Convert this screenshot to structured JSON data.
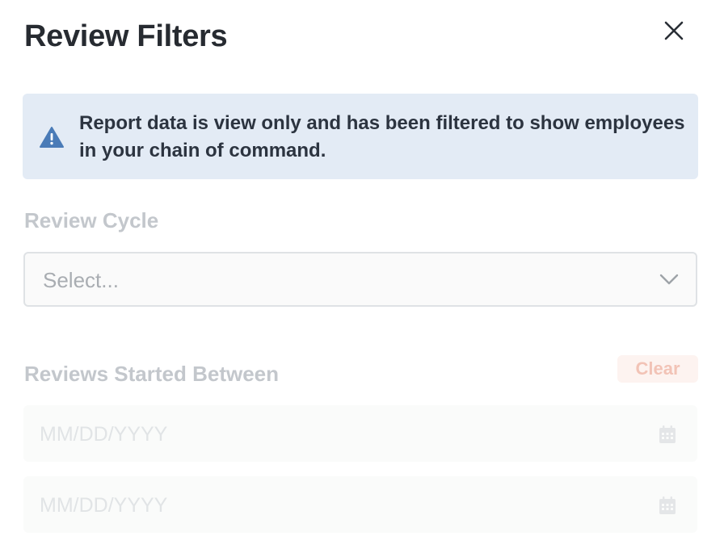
{
  "dialog": {
    "title": "Review Filters",
    "close_icon": "close-icon"
  },
  "alert": {
    "icon": "warning-triangle-icon",
    "message": "Report data is view only and has been filtered to show employees in your chain of command."
  },
  "review_cycle": {
    "label": "Review Cycle",
    "placeholder": "Select...",
    "icon": "chevron-down-icon"
  },
  "reviews_started": {
    "label": "Reviews Started Between",
    "clear_label": "Clear",
    "start_placeholder": "MM/DD/YYYY",
    "end_placeholder": "MM/DD/YYYY",
    "icon": "calendar-icon"
  },
  "colors": {
    "alert_background": "#e3ebf5",
    "alert_icon": "#4a7bb7",
    "clear_text": "#f2c3b6",
    "clear_background": "#fdf3f0"
  }
}
